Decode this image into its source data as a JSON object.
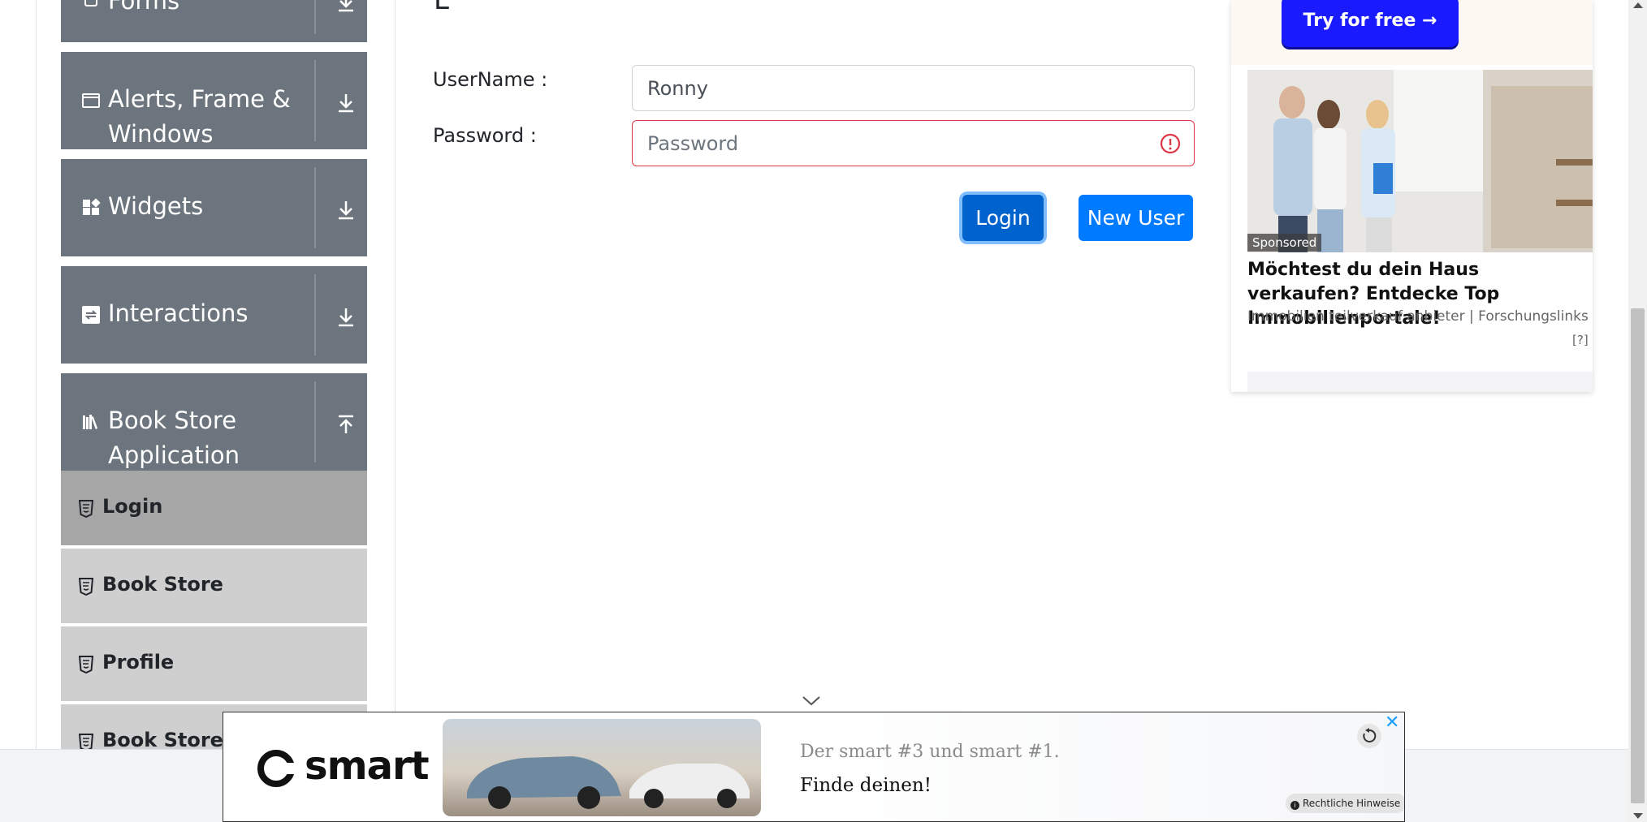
{
  "sidebar": {
    "groups": [
      {
        "label": "Forms",
        "icon": "document-icon",
        "expanded": false
      },
      {
        "label": "Alerts, Frame &",
        "label2": "Windows",
        "icon": "window-icon",
        "expanded": false
      },
      {
        "label": "Widgets",
        "icon": "widgets-icon",
        "expanded": false
      },
      {
        "label": "Interactions",
        "icon": "interactions-icon",
        "expanded": false
      },
      {
        "label": "Book Store",
        "label2": "Application",
        "icon": "books-icon",
        "expanded": true
      }
    ],
    "items": [
      {
        "label": "Login",
        "active": true
      },
      {
        "label": "Book Store",
        "active": false
      },
      {
        "label": "Profile",
        "active": false
      },
      {
        "label": "Book Store API",
        "active": false
      }
    ]
  },
  "form": {
    "username_label": "UserName :",
    "username_value": "Ronny",
    "password_label": "Password :",
    "password_placeholder": "Password",
    "login_button": "Login",
    "new_user_button": "New User"
  },
  "right_ad": {
    "cta": "Try for free →",
    "sponsored": "Sponsored",
    "headline": "Möchtest du dein Haus verkaufen? Entdecke Top Immobilienportale!",
    "subline": "Immobilien teilverkauf anbieter | Forschungslinks",
    "help": "[?]"
  },
  "banner_ad": {
    "brand": "smart",
    "line1": "Der smart #3 und smart #1.",
    "line2": "Finde deinen!",
    "legal": "Rechtliche Hinweise",
    "close": "✕"
  },
  "colors": {
    "primary": "#007bff",
    "sidebar_header": "#6c757d",
    "menu_item": "#cfcfcf",
    "menu_item_active": "#a6a6a6",
    "invalid": "#dc3545"
  }
}
